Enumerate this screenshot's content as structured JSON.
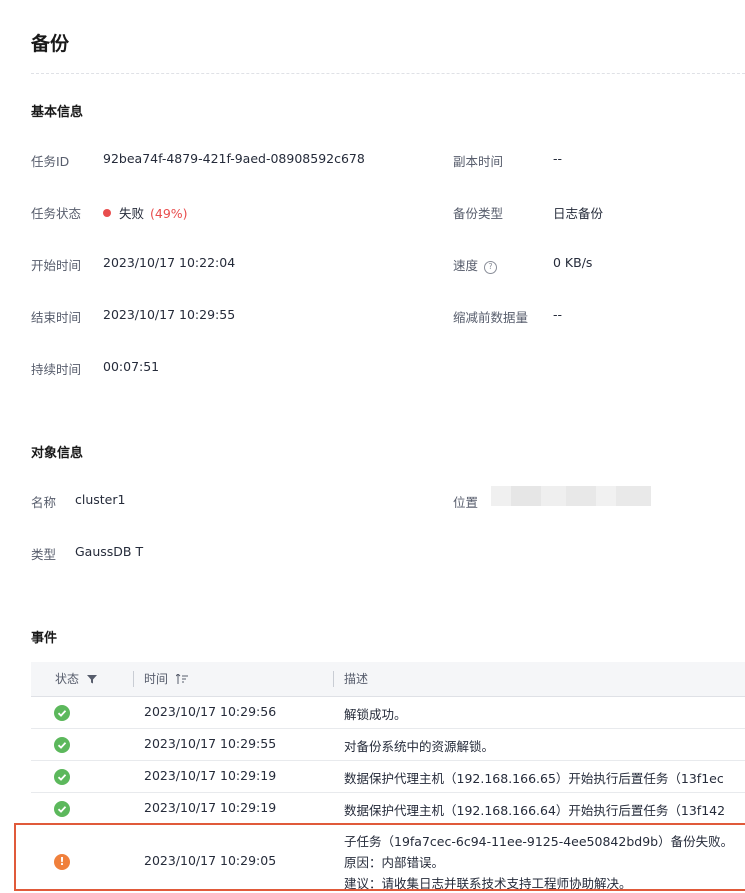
{
  "page": {
    "title": "备份"
  },
  "basic": {
    "section_title": "基本信息",
    "task_id": {
      "label": "任务ID",
      "value": "92bea74f-4879-421f-9aed-08908592c678"
    },
    "replica_time": {
      "label": "副本时间",
      "value": "--"
    },
    "task_status": {
      "label": "任务状态",
      "value": "失败",
      "percent": "(49%)",
      "status_color": "#e84d4d"
    },
    "backup_type": {
      "label": "备份类型",
      "value": "日志备份"
    },
    "start_time": {
      "label": "开始时间",
      "value": "2023/10/17 10:22:04"
    },
    "speed": {
      "label": "速度",
      "value": "0 KB/s",
      "icon": "help-icon"
    },
    "end_time": {
      "label": "结束时间",
      "value": "2023/10/17 10:29:55"
    },
    "pre_reduction": {
      "label": "缩减前数据量",
      "value": "--"
    },
    "duration": {
      "label": "持续时间",
      "value": "00:07:51"
    }
  },
  "object": {
    "section_title": "对象信息",
    "name": {
      "label": "名称",
      "value": "cluster1"
    },
    "location": {
      "label": "位置"
    },
    "type": {
      "label": "类型",
      "value": "GaussDB T"
    }
  },
  "events": {
    "section_title": "事件",
    "columns": {
      "status": "状态",
      "time": "时间",
      "description": "描述"
    },
    "rows": [
      {
        "status": "success",
        "time": "2023/10/17 10:29:56",
        "description": "解锁成功。"
      },
      {
        "status": "success",
        "time": "2023/10/17 10:29:55",
        "description": "对备份系统中的资源解锁。"
      },
      {
        "status": "success",
        "time": "2023/10/17 10:29:19",
        "description": "数据保护代理主机（192.168.166.65）开始执行后置任务（13f1ec"
      },
      {
        "status": "success",
        "time": "2023/10/17 10:29:19",
        "description": "数据保护代理主机（192.168.166.64）开始执行后置任务（13f142"
      },
      {
        "status": "warning",
        "time": "2023/10/17 10:29:05",
        "description_lines": [
          "子任务（19fa7cec-6c94-11ee-9125-4ee50842bd9b）备份失败。",
          "原因：内部错误。",
          "建议：请收集日志并联系技术支持工程师协助解决。"
        ]
      }
    ]
  },
  "colors": {
    "success": "#5cb85c",
    "warning": "#f0803c",
    "error": "#e84d4d",
    "highlight_border": "#e05a3a"
  }
}
